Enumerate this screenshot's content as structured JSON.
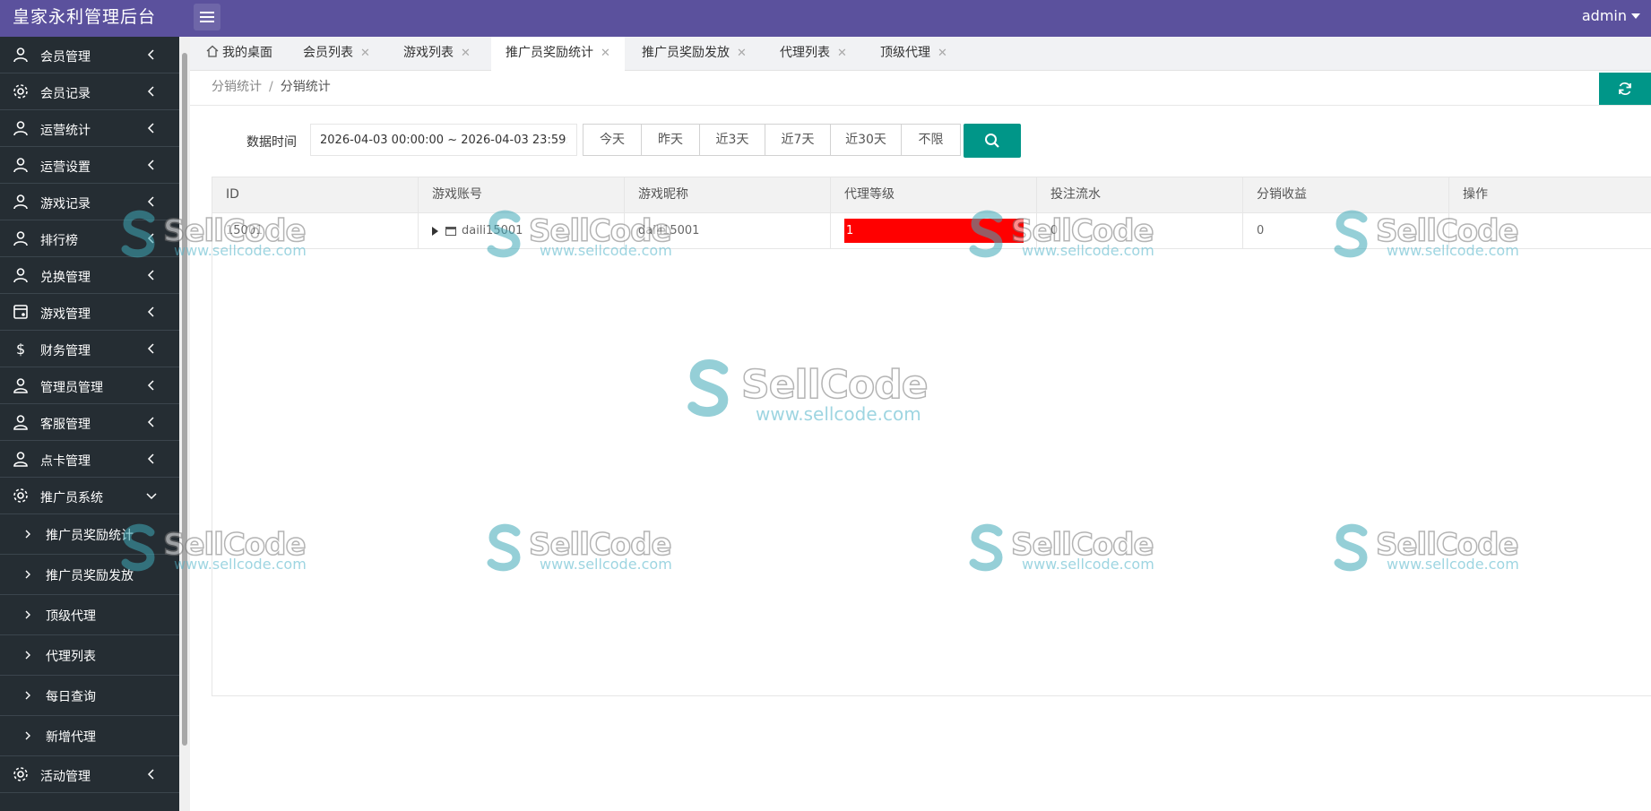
{
  "header": {
    "title": "皇家永利管理后台",
    "user": "admin"
  },
  "sidebar": {
    "items": [
      {
        "label": "会员管理",
        "icon": "user-icon"
      },
      {
        "label": "会员记录",
        "icon": "gear-icon"
      },
      {
        "label": "运营统计",
        "icon": "user-icon"
      },
      {
        "label": "运营设置",
        "icon": "user-icon"
      },
      {
        "label": "游戏记录",
        "icon": "user-icon"
      },
      {
        "label": "排行榜",
        "icon": "user-icon"
      },
      {
        "label": "兑换管理",
        "icon": "user-icon"
      },
      {
        "label": "游戏管理",
        "icon": "game-icon"
      },
      {
        "label": "财务管理",
        "icon": "dollar-icon"
      },
      {
        "label": "管理员管理",
        "icon": "admin-icon"
      },
      {
        "label": "客服管理",
        "icon": "admin-icon"
      },
      {
        "label": "点卡管理",
        "icon": "admin-icon"
      },
      {
        "label": "推广员系统",
        "icon": "gear-icon"
      }
    ],
    "sub_items": [
      "推广员奖励统计",
      "推广员奖励发放",
      "顶级代理",
      "代理列表",
      "每日查询",
      "新增代理"
    ],
    "last_item": {
      "label": "活动管理",
      "icon": "gear-icon"
    }
  },
  "tabs": [
    {
      "label": "我的桌面"
    },
    {
      "label": "会员列表"
    },
    {
      "label": "游戏列表"
    },
    {
      "label": "推广员奖励统计"
    },
    {
      "label": "推广员奖励发放"
    },
    {
      "label": "代理列表"
    },
    {
      "label": "顶级代理"
    }
  ],
  "breadcrumb": {
    "parent": "分销统计",
    "separator": "/",
    "current": "分销统计"
  },
  "filter": {
    "label": "数据时间",
    "date_range": "2026-04-03 00:00:00 ~ 2026-04-03 23:59:59",
    "ranges": [
      "今天",
      "昨天",
      "近3天",
      "近7天",
      "近30天",
      "不限"
    ]
  },
  "table": {
    "columns": [
      "ID",
      "游戏账号",
      "游戏昵称",
      "代理等级",
      "投注流水",
      "分销收益",
      "操作"
    ],
    "rows": [
      {
        "id": "15001",
        "account": "daili15001",
        "nickname": "daili15001",
        "level": "1",
        "bet_flow": "0",
        "income": "0",
        "action": ""
      }
    ]
  },
  "watermark": {
    "brand": "SellCode",
    "url": "www.sellcode.com"
  },
  "colors": {
    "header": "#5b519d",
    "sidebar": "#252d33",
    "accent": "#009688",
    "level_bar": "#ff0000"
  }
}
